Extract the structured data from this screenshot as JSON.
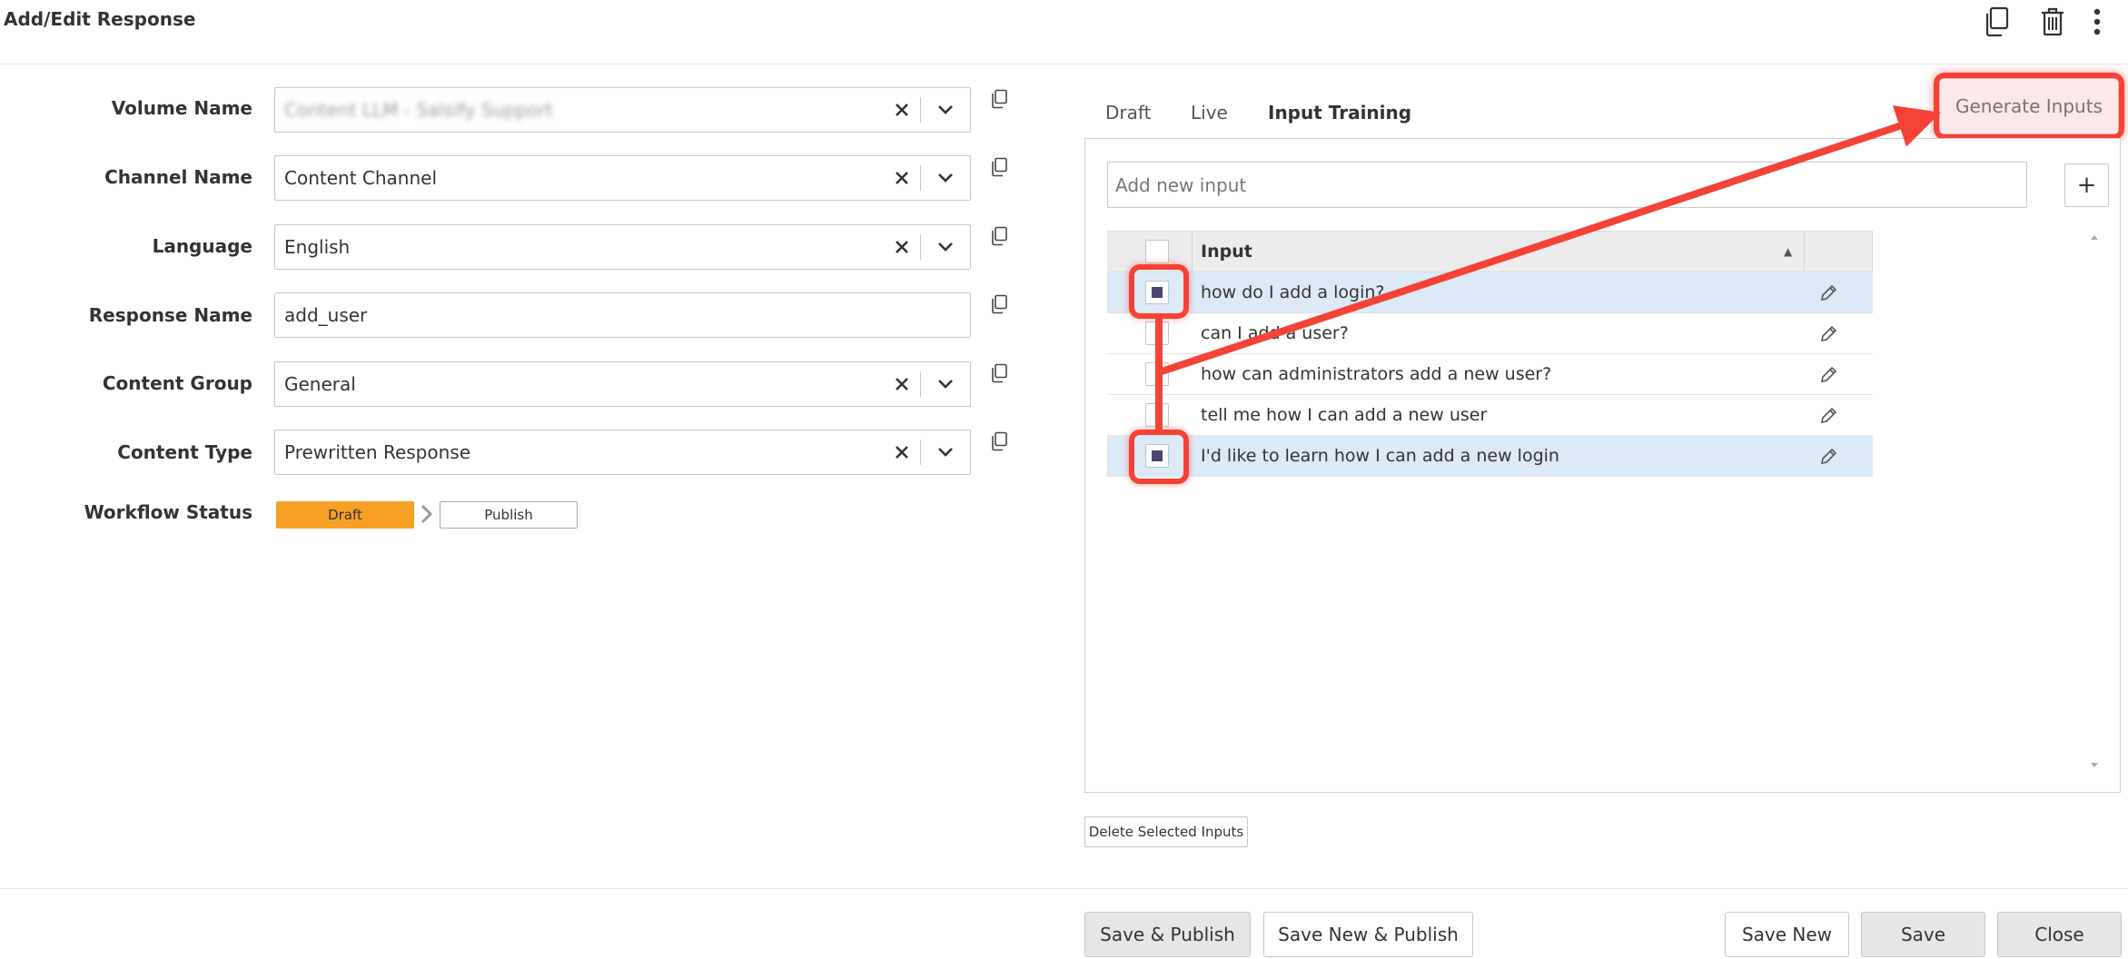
{
  "header": {
    "title": "Add/Edit Response",
    "icons": [
      "copy-icon",
      "trash-icon",
      "more-vertical-icon"
    ]
  },
  "form": {
    "fields": [
      {
        "label": "Volume Name",
        "value": "Content LLM - Salsify Support",
        "type": "select",
        "blurred": true
      },
      {
        "label": "Channel Name",
        "value": "Content Channel",
        "type": "select"
      },
      {
        "label": "Language",
        "value": "English",
        "type": "select"
      },
      {
        "label": "Response Name",
        "value": "add_user",
        "type": "text"
      },
      {
        "label": "Content Group",
        "value": "General",
        "type": "select"
      },
      {
        "label": "Content Type",
        "value": "Prewritten Response",
        "type": "select"
      }
    ],
    "workflow": {
      "label": "Workflow Status",
      "steps": [
        "Draft",
        "Publish"
      ],
      "active_step": "Draft"
    }
  },
  "tabs": [
    {
      "label": "Draft",
      "active": false
    },
    {
      "label": "Live",
      "active": false
    },
    {
      "label": "Input Training",
      "active": true
    }
  ],
  "generate_inputs_label": "Generate Inputs",
  "input_training": {
    "new_input_placeholder": "Add new input",
    "add_button_label": "+",
    "column_header": "Input",
    "sort_indicator": "▲",
    "rows": [
      {
        "text": "how do I add a login?",
        "selected": true
      },
      {
        "text": "can I add a user?",
        "selected": false
      },
      {
        "text": "how can administrators add a new user?",
        "selected": false
      },
      {
        "text": "tell me how I can add a new user",
        "selected": false
      },
      {
        "text": "I'd like to learn how I can add a new login",
        "selected": true
      }
    ],
    "delete_selected_label": "Delete Selected Inputs"
  },
  "footer": {
    "save_publish": "Save & Publish",
    "save_new_publish": "Save New & Publish",
    "save_new": "Save New",
    "save": "Save",
    "close": "Close"
  },
  "colors": {
    "draft_step": "#f7a025",
    "selected_row": "#dce9f7",
    "annotation": "#f44336"
  }
}
